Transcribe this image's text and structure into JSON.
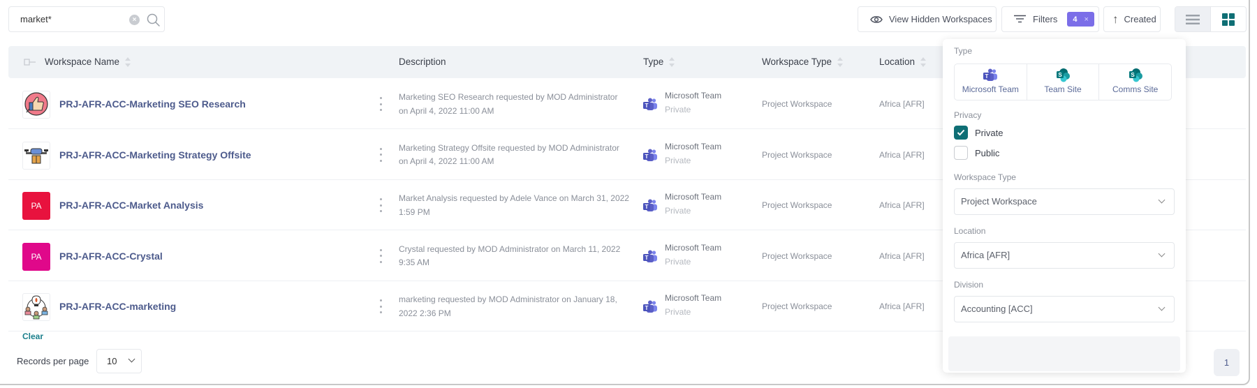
{
  "search": {
    "value": "market*",
    "placeholder": ""
  },
  "toolbar": {
    "view_hidden_label": "View Hidden Workspaces",
    "filters_label": "Filters",
    "filters_count": "4",
    "filters_clear": "×",
    "sort_label": "Created"
  },
  "table": {
    "columns": {
      "name": "Workspace Name",
      "description": "Description",
      "type": "Type",
      "workspace_type": "Workspace Type",
      "location": "Location"
    },
    "rows": [
      {
        "name": "PRJ-AFR-ACC-Marketing SEO Research",
        "thumb": "thumbs-up-icon",
        "thumb_text": "",
        "description": "Marketing SEO Research requested by MOD Administrator on April 4, 2022 11:00 AM",
        "type": "Microsoft Team",
        "privacy": "Private",
        "workspace_type": "Project Workspace",
        "location": "Africa [AFR]"
      },
      {
        "name": "PRJ-AFR-ACC-Marketing Strategy Offsite",
        "thumb": "drone-icon",
        "thumb_text": "",
        "description": "Marketing Strategy Offsite requested by MOD Administrator on April 4, 2022 11:00 AM",
        "type": "Microsoft Team",
        "privacy": "Private",
        "workspace_type": "Project Workspace",
        "location": "Africa [AFR]"
      },
      {
        "name": "PRJ-AFR-ACC-Market Analysis",
        "thumb": "initials",
        "thumb_text": "PA",
        "thumb_color": "#e8123e",
        "description": "Market Analysis requested by Adele Vance on March 31, 2022 1:59 PM",
        "type": "Microsoft Team",
        "privacy": "Private",
        "workspace_type": "Project Workspace",
        "location": "Africa [AFR]"
      },
      {
        "name": "PRJ-AFR-ACC-Crystal",
        "thumb": "initials",
        "thumb_text": "PA",
        "thumb_color": "#e0088a",
        "description": "Crystal requested by MOD Administrator on March 11, 2022 9:35 AM",
        "type": "Microsoft Team",
        "privacy": "Private",
        "workspace_type": "Project Workspace",
        "location": "Africa [AFR]"
      },
      {
        "name": "PRJ-AFR-ACC-marketing",
        "thumb": "idea-team-icon",
        "thumb_text": "",
        "description": "marketing requested by MOD Administrator on January 18, 2022 2:36 PM",
        "type": "Microsoft Team",
        "privacy": "Private",
        "workspace_type": "Project Workspace",
        "location": "Africa [AFR]"
      }
    ]
  },
  "footer": {
    "records_label": "Records per page",
    "records_value": "10",
    "current_page": "1"
  },
  "filter_panel": {
    "type_label": "Type",
    "type_options": [
      "Microsoft Team",
      "Team Site",
      "Comms Site"
    ],
    "privacy_label": "Privacy",
    "privacy_options": [
      {
        "label": "Private",
        "checked": true
      },
      {
        "label": "Public",
        "checked": false
      }
    ],
    "workspace_type_label": "Workspace Type",
    "workspace_type_value": "Project Workspace",
    "location_label": "Location",
    "location_value": "Africa [AFR]",
    "division_label": "Division",
    "division_value": "Accounting [ACC]",
    "clear_label": "Clear"
  },
  "colors": {
    "accent_teal": "#0f6f75",
    "badge_purple": "#7b6ee8",
    "link_blue": "#4d5b8c",
    "teams_purple": "#5b5fc7",
    "sharepoint_teal": "#038387"
  }
}
